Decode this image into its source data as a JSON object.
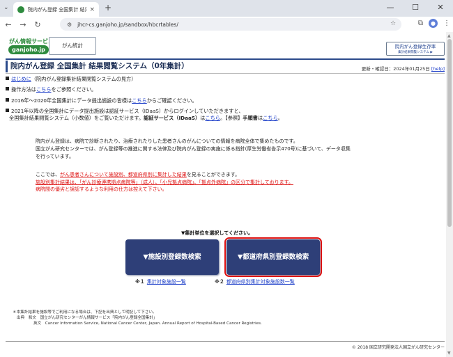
{
  "browser": {
    "tab_title": "院内がん登録 全国集計 結果閲覧",
    "tab_close": "×",
    "new_tab": "+",
    "url": "jhcr-cs.ganjoho.jp/sandbox/hbcrtables/",
    "win_minimize": "—",
    "win_maximize": "☐",
    "win_close": "✕",
    "avatar_letter": "👤"
  },
  "header": {
    "logo_top": "がん情報サービス",
    "logo_name": "ganjoho.jp",
    "stats_button": "がん統計",
    "right_button_line1": "院内がん登録生存率",
    "right_button_line2": "集計結果閲覧システム ▶"
  },
  "title": "院内がん登録 全国集計 結果閲覧システム（0年集計）",
  "updated": {
    "text": "更新・確認日：2024年01月25日",
    "help_label": "[help]"
  },
  "bullets": {
    "b1_link": "はじめに",
    "b1_text": "（院内がん登録集計結果閲覧システムの見方）",
    "b2_pre": "操作方法は",
    "b2_link": "こちら",
    "b2_post": "をご参照ください。",
    "b3_pre": "2016年～2020年全国集計にデータ提出施設の皆様は",
    "b3_link": "こちら",
    "b3_post": "からご確認ください。",
    "b4_line1": "2021年以降の全国集計にデータ提出施設は認証サービス（IDaaS）からログインしていただきますと、",
    "b4_line2_pre": "全国集計結果閲覧システム（小数値）をご覧いただけます。",
    "b4_bold": "認証サービス（IDaaS）",
    "b4_mid": "は",
    "b4_link1": "こちら",
    "b4_mid2": "。【参照】",
    "b4_bold2": "手順書",
    "b4_mid3": "は",
    "b4_link2": "こちら",
    "b4_end": "。"
  },
  "intro": {
    "line1": "院内がん登録は、病院で診断されたり、治療されたりした患者さんのがんについての情報を病院全体で集めたものです。",
    "line2": "国立がん研究センターでは、がん登録等の推進に関する法律及び院内がん登録の実施に係る指針(厚生労働省告示470号)に基づいて、データ収集",
    "line3": "を行っています。"
  },
  "red": {
    "line1_pre": "ここでは、",
    "line1_ul": "がん患者さんについて施設別、都道府県別に集計した結果",
    "line1_post": "を見ることができます。",
    "line2": "施設別集計結果は、「がん診療連携拠点病院等」（成人）、「小児拠点病院」、「拠点外病院」の区分で集計しております。",
    "line3": "病院間の優劣と誤認するような利用の仕方は控えて下さい。"
  },
  "selection": {
    "caption": "▼集計単位を選択してください。",
    "btn_facility": "▼施設別登録数検索",
    "btn_prefecture": "▼都道府県別登録数検索",
    "note1_num": "※１",
    "note1_link": "集計対象施設一覧",
    "note2_num": "※２",
    "note2_link": "都道府県別集計対象施設数一覧"
  },
  "footnote": {
    "line1": "＊本集計結果を施設等でご利用になる場合は、下記を出典として明記して下さい。",
    "line2": "出典　和文　国立がん研究センターがん情報サービス「院内がん登録全国集計」",
    "line3": "英文　Cancer Information Service, National Cancer Center, Japan. Annual Report of Hospital-Based Cancer Registries."
  },
  "copyright": "© 2018 国立研究開発法人国立がん研究センター"
}
